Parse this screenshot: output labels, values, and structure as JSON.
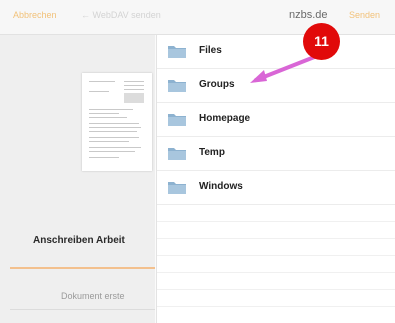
{
  "nav": {
    "cancel_label": "Abbrechen",
    "location_label": "← WebDAV senden",
    "host_label": "nzbs.de",
    "send_label": "Senden"
  },
  "document": {
    "title": "Anschreiben Arbeit",
    "action_label": "Dokument erste"
  },
  "folders": [
    {
      "name": "Files"
    },
    {
      "name": "Groups"
    },
    {
      "name": "Homepage"
    },
    {
      "name": "Temp"
    },
    {
      "name": "Windows"
    }
  ],
  "annotation": {
    "step_number": "11"
  },
  "colors": {
    "accent_orange": "#f2c27a",
    "folder_blue": "#a8c6de",
    "folder_blue_dark": "#8db2d0",
    "badge_red": "#e10a0a",
    "arrow_pink": "#d966d6"
  }
}
